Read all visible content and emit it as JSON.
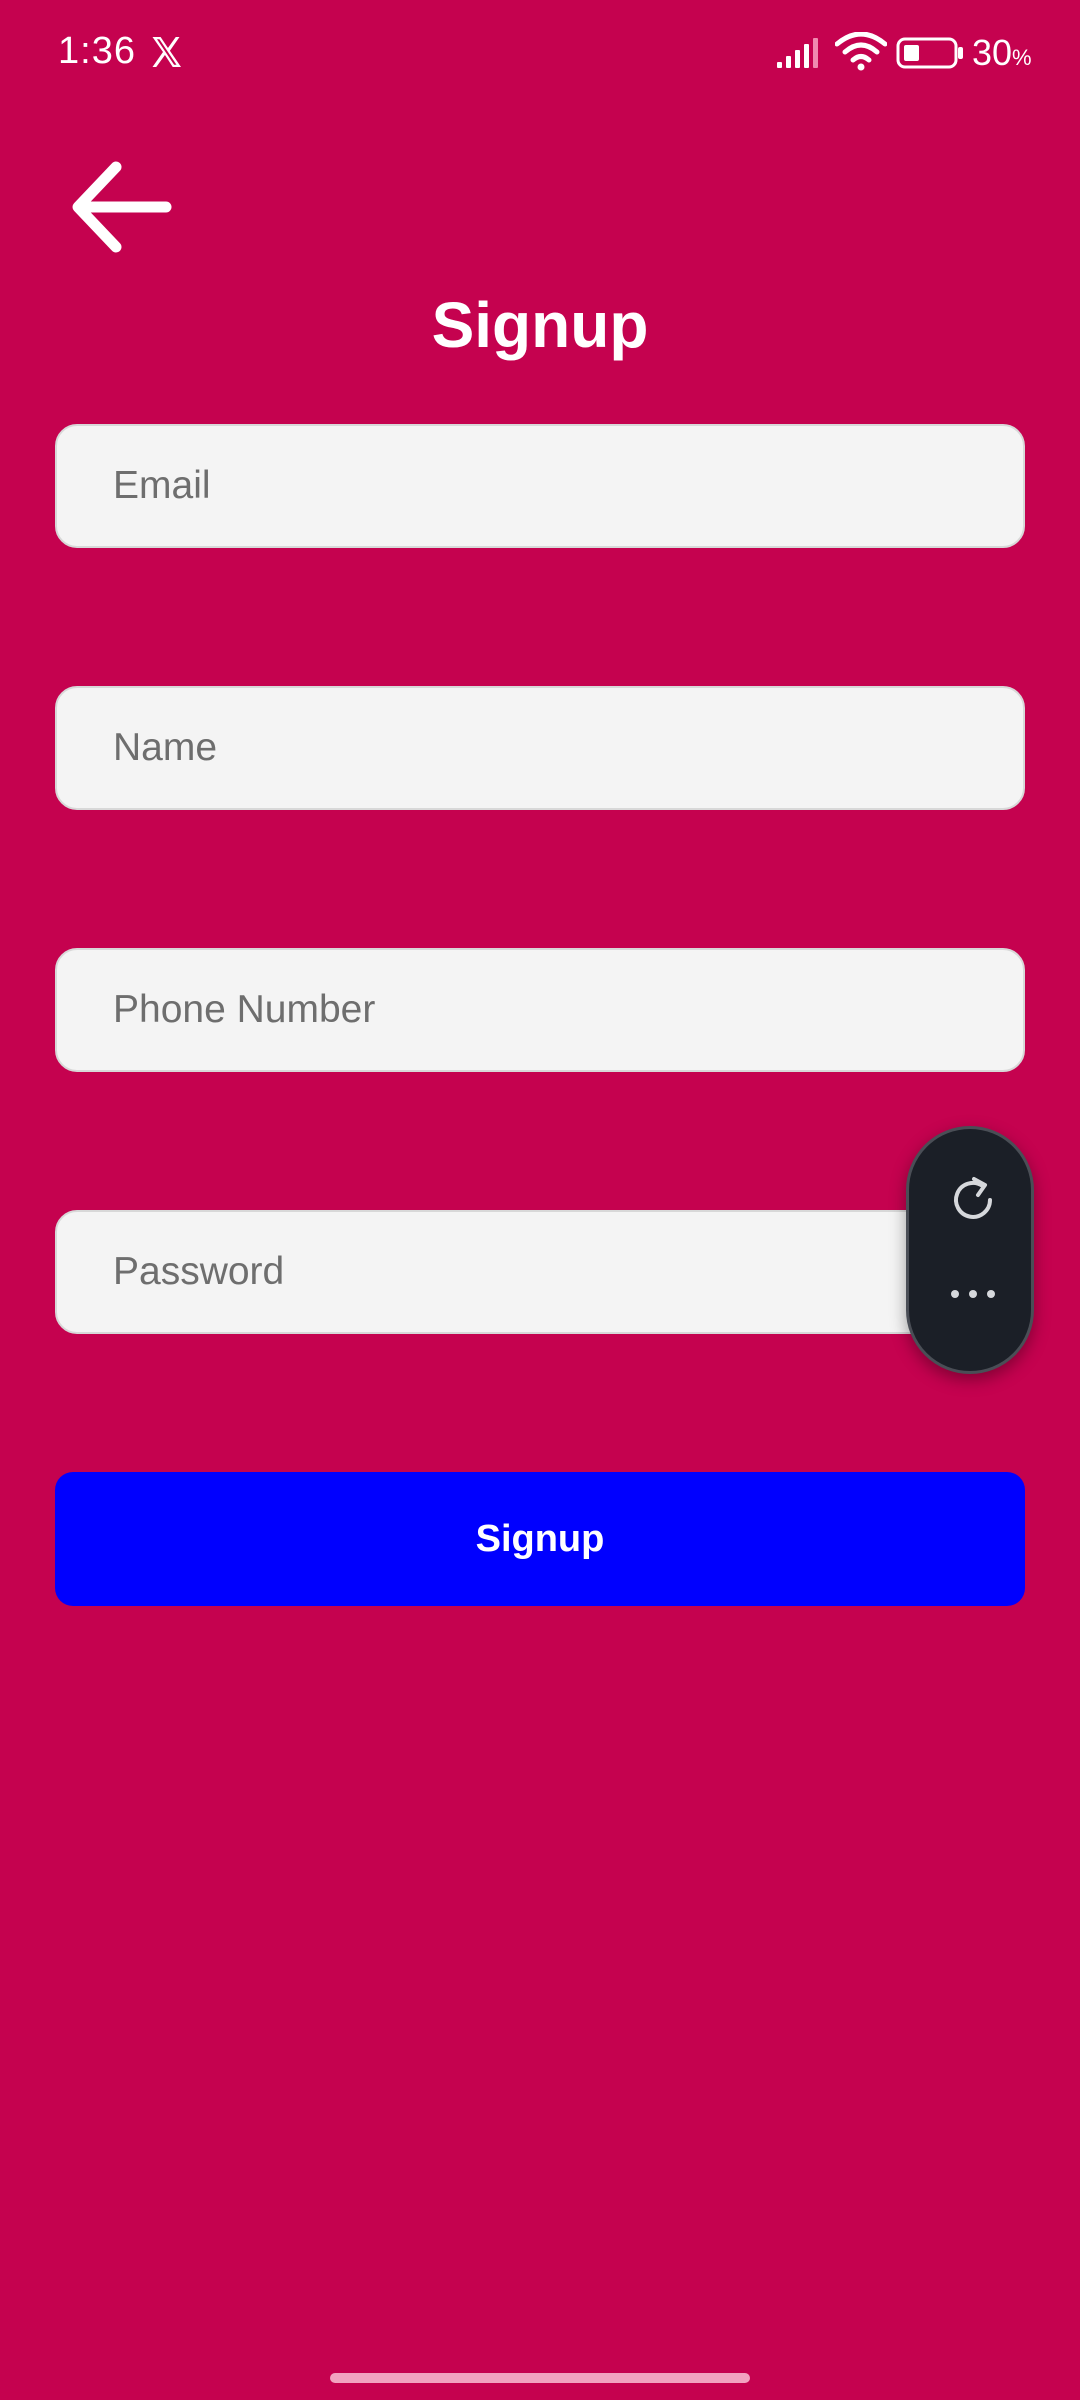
{
  "status_bar": {
    "time": "1:36",
    "battery_value": "30",
    "battery_unit": "%",
    "icons": [
      "x-logo-icon",
      "signal-icon",
      "wifi-icon",
      "battery-icon"
    ]
  },
  "header": {
    "back_icon": "arrow-left-icon",
    "title": "Signup"
  },
  "form": {
    "email": {
      "placeholder": "Email",
      "value": ""
    },
    "name": {
      "placeholder": "Name",
      "value": ""
    },
    "phone": {
      "placeholder": "Phone Number",
      "value": ""
    },
    "password": {
      "placeholder": "Password",
      "value": ""
    },
    "submit_label": "Signup"
  },
  "floating_pill": {
    "icons": [
      "refresh-icon",
      "more-dots-icon"
    ]
  },
  "colors": {
    "background": "#C5024F",
    "input_background": "#F4F4F4",
    "button": "#0000FF",
    "pill": "#1B1F27"
  }
}
